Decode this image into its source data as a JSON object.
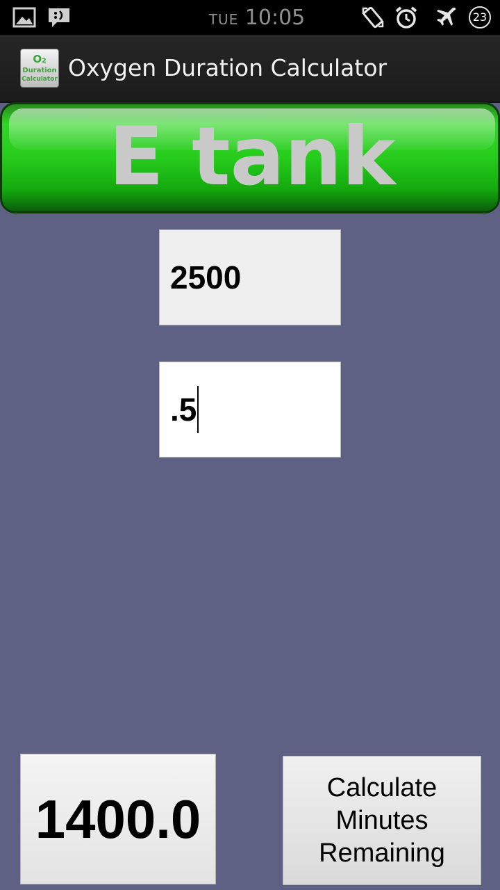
{
  "status_bar": {
    "day": "TUE",
    "time": "10:05",
    "battery_level": "23",
    "icons": [
      "gallery-icon",
      "message-icon",
      "rotate-icon",
      "alarm-icon",
      "airplane-mode-icon",
      "battery-icon"
    ]
  },
  "action_bar": {
    "title": "Oxygen Duration Calculator",
    "logo": {
      "line1": "O₂",
      "line2": "Duration",
      "line3": "Calculator"
    }
  },
  "banner": {
    "label": "E tank",
    "color": "#27cc1d"
  },
  "inputs": {
    "pressure_value": "2500",
    "flow_value": ".5"
  },
  "result": {
    "value": "1400.0"
  },
  "calculate_button": {
    "line1": "Calculate",
    "line2": "Minutes",
    "line3": "Remaining"
  },
  "colors": {
    "background": "#5f6184",
    "status_bar": "#000000",
    "action_bar": "#222222",
    "banner_green": "#27cc1d"
  }
}
